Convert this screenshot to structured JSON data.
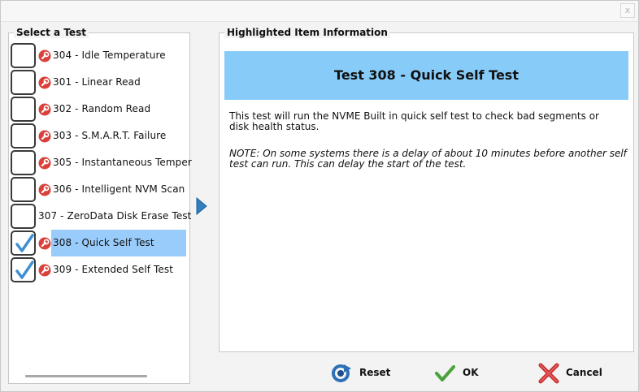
{
  "window": {
    "close_glyph": "x"
  },
  "list_group": {
    "title": "Select a Test"
  },
  "tests": [
    {
      "label": "304 - Idle Temperature",
      "checked": false,
      "icon": "wrench-icon",
      "selected": false
    },
    {
      "label": "301 - Linear Read",
      "checked": false,
      "icon": "wrench-icon",
      "selected": false
    },
    {
      "label": "302 - Random Read",
      "checked": false,
      "icon": "wrench-icon",
      "selected": false
    },
    {
      "label": "303 - S.M.A.R.T. Failure",
      "checked": false,
      "icon": "wrench-icon",
      "selected": false
    },
    {
      "label": "305 - Instantaneous Temper",
      "checked": false,
      "icon": "wrench-icon",
      "selected": false
    },
    {
      "label": "306 - Intelligent NVM Scan",
      "checked": false,
      "icon": "wrench-icon",
      "selected": false
    },
    {
      "label": "307 - ZeroData Disk Erase Test",
      "checked": false,
      "icon": null,
      "selected": false
    },
    {
      "label": "308 - Quick Self Test",
      "checked": true,
      "icon": "wrench-icon",
      "selected": true
    },
    {
      "label": "309 - Extended Self Test",
      "checked": true,
      "icon": "wrench-icon",
      "selected": false
    }
  ],
  "info_group": {
    "title": "Highlighted Item Information",
    "header": "Test 308 - Quick Self Test",
    "description": "This test will run the NVME Built in quick self test to check bad segments or disk health status.",
    "note": "NOTE: On some systems there is a delay of about 10 minutes before another self test can run. This can delay the start of the test."
  },
  "buttons": {
    "reset": "Reset",
    "ok": "OK",
    "cancel": "Cancel"
  },
  "colors": {
    "selection": "#99ccfa",
    "header_bg": "#87ccf9",
    "check": "#3d8fd6",
    "wrench": "#d9413a"
  }
}
